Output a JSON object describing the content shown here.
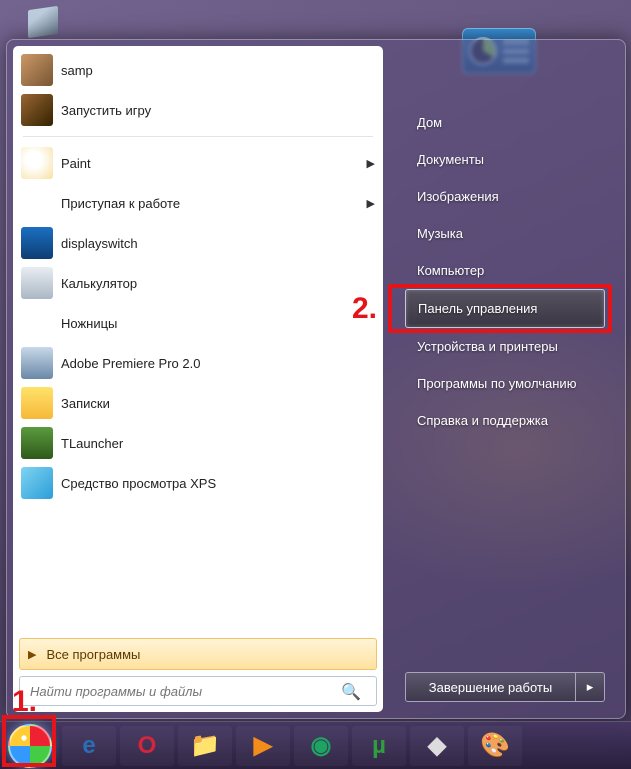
{
  "annotations": {
    "one": "1.",
    "two": "2."
  },
  "start_menu": {
    "pinned": [
      {
        "label": "samp",
        "icon": "ic-samp"
      },
      {
        "label": "Запустить игру",
        "icon": "ic-run"
      }
    ],
    "recent": [
      {
        "label": "Paint",
        "icon": "ic-paint",
        "arrow": true
      },
      {
        "label": "Приступая к работе",
        "icon": "ic-start",
        "arrow": true
      },
      {
        "label": "displayswitch",
        "icon": "ic-display",
        "arrow": false
      },
      {
        "label": "Калькулятор",
        "icon": "ic-calc",
        "arrow": false
      },
      {
        "label": "Ножницы",
        "icon": "ic-snip",
        "arrow": false
      },
      {
        "label": "Adobe Premiere Pro 2.0",
        "icon": "ic-premiere",
        "arrow": false
      },
      {
        "label": "Записки",
        "icon": "ic-notes",
        "arrow": false
      },
      {
        "label": "TLauncher",
        "icon": "ic-tl",
        "arrow": false
      },
      {
        "label": "Средство просмотра XPS",
        "icon": "ic-xps",
        "arrow": false
      }
    ],
    "all_programs": "Все программы",
    "search_placeholder": "Найти программы и файлы",
    "right": [
      "Дом",
      "Документы",
      "Изображения",
      "Музыка",
      "Компьютер",
      "Панель управления",
      "Устройства и принтеры",
      "Программы по умолчанию",
      "Справка и поддержка"
    ],
    "right_highlight_index": 5,
    "shutdown": "Завершение работы"
  },
  "taskbar": {
    "items": [
      {
        "name": "ie-icon",
        "glyph": "e",
        "color": "#2a6db5"
      },
      {
        "name": "opera-icon",
        "glyph": "O",
        "color": "#d6243a"
      },
      {
        "name": "explorer-icon",
        "glyph": "📁",
        "color": ""
      },
      {
        "name": "wmp-icon",
        "glyph": "▶",
        "color": "#f28c1b"
      },
      {
        "name": "chrome-icon",
        "glyph": "◉",
        "color": "#1da462"
      },
      {
        "name": "utorrent-icon",
        "glyph": "µ",
        "color": "#2e9e3e"
      },
      {
        "name": "unity-icon",
        "glyph": "◆",
        "color": "#dcdcdc"
      },
      {
        "name": "paint-icon",
        "glyph": "🎨",
        "color": ""
      }
    ]
  }
}
